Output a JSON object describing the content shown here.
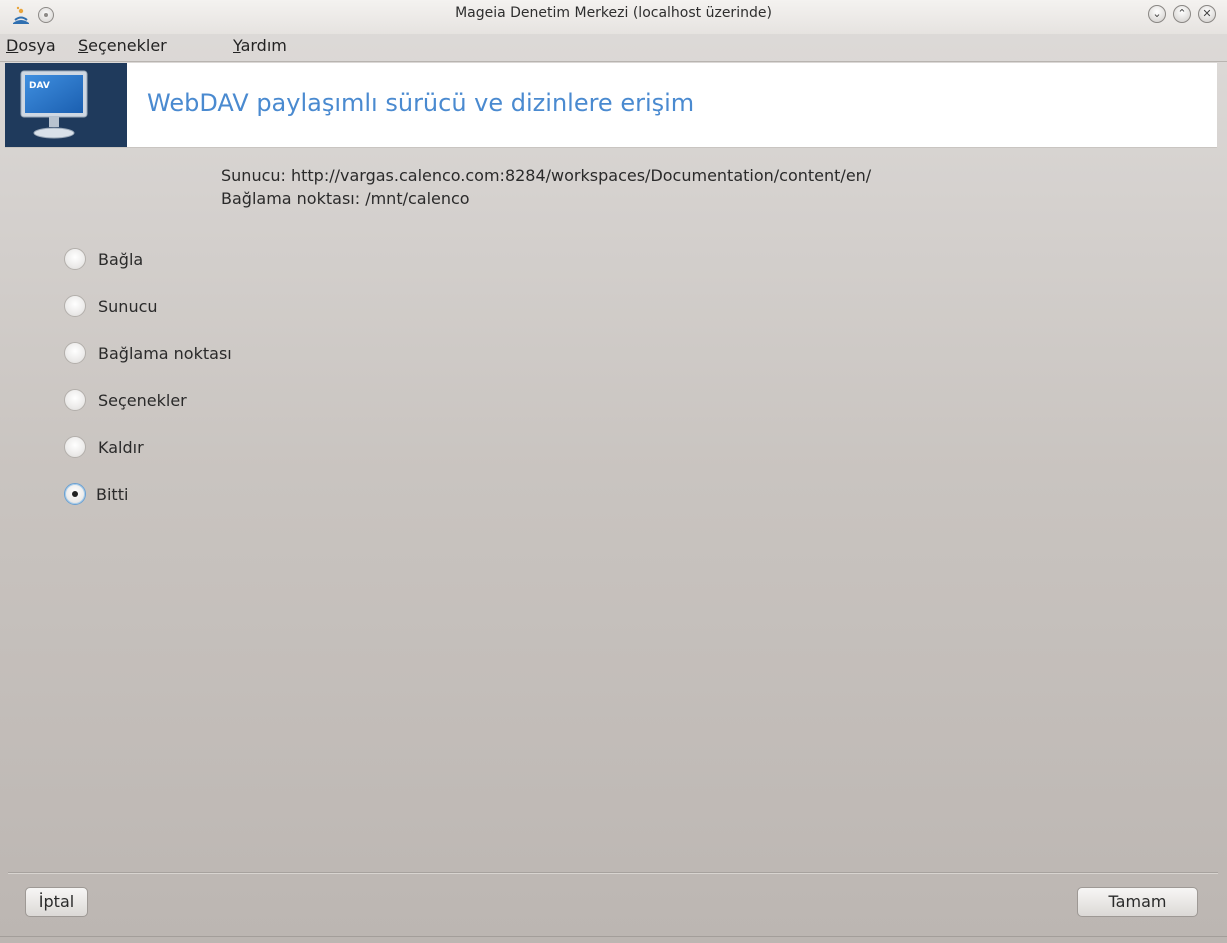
{
  "window": {
    "title": "Mageia Denetim Merkezi  (localhost üzerinde)",
    "controls": [
      "minimize-icon",
      "maximize-icon",
      "close-icon"
    ]
  },
  "menu": [
    {
      "accel": "D",
      "rest": "osya"
    },
    {
      "accel": "S",
      "rest": "eçenekler"
    },
    {
      "accel": "Y",
      "rest": "ardım"
    }
  ],
  "header": {
    "title": "WebDAV paylaşımlı sürücü ve dizinlere erişim",
    "icon_text": "DAV",
    "icon": "monitor-dav-icon"
  },
  "info": {
    "server_line": "Sunucu: http://vargas.calenco.com:8284/workspaces/Documentation/content/en/",
    "mount_line": "Bağlama noktası: /mnt/calenco"
  },
  "options": [
    {
      "label": "Bağla",
      "checked": false
    },
    {
      "label": "Sunucu",
      "checked": false
    },
    {
      "label": "Bağlama noktası",
      "checked": false
    },
    {
      "label": "Seçenekler",
      "checked": false
    },
    {
      "label": "Kaldır",
      "checked": false
    },
    {
      "label": "Bitti",
      "checked": true
    }
  ],
  "buttons": {
    "cancel": "İptal",
    "ok": "Tamam"
  },
  "colors": {
    "accent": "#4a8ad0",
    "icon_bg": "#1f3a5c"
  }
}
